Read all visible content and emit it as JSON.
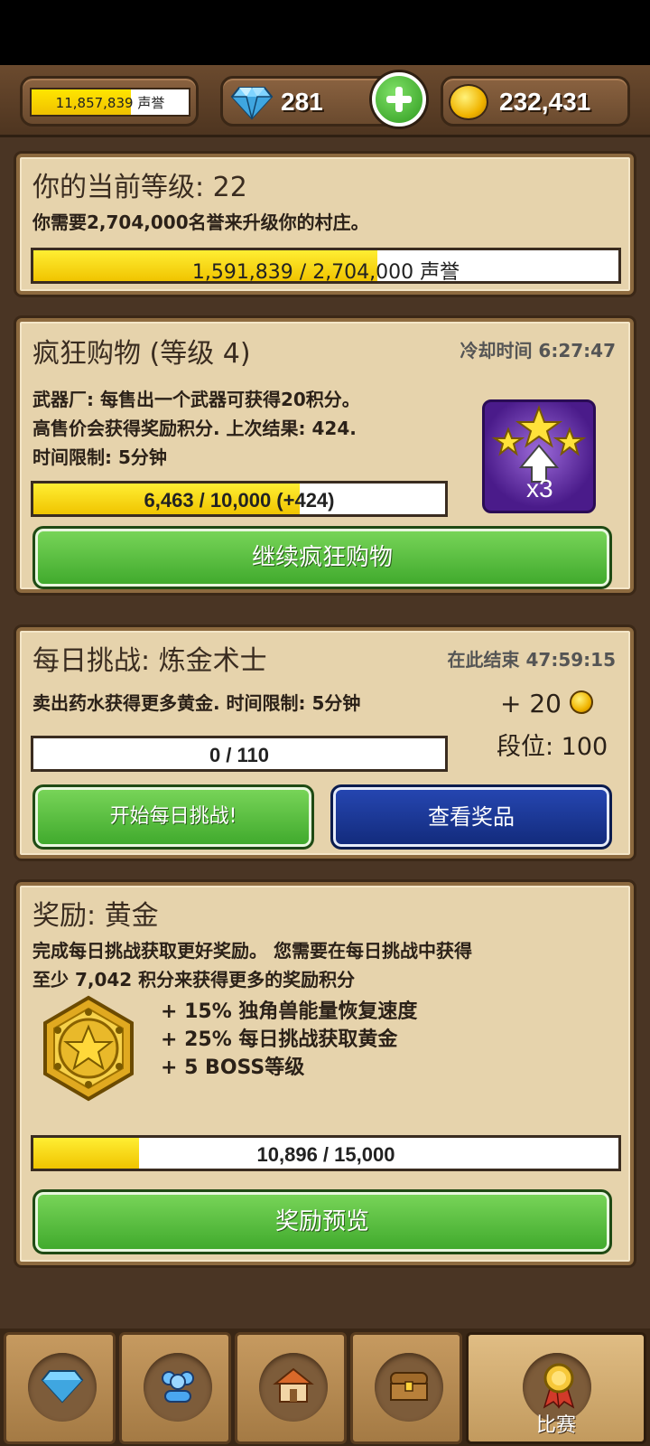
{
  "topbar": {
    "fame_text": "11,857,839 声誉",
    "fame_progress": 0.63,
    "gems": "281",
    "gold": "232,431"
  },
  "level_panel": {
    "title": "你的当前等级: 22",
    "description": "你需要2,704,000名誉来升级你的村庄。",
    "progress_text": "1,591,839 / 2,704,000 声誉",
    "progress": 0.5887
  },
  "shopping_panel": {
    "title": "疯狂购物 (等级 4)",
    "cooldown": "冷却时间 6:27:47",
    "line1": "武器厂: 每售出一个武器可获得20积分。",
    "line2": "高售价会获得奖励积分. 上次结果: 424.",
    "line3": "时间限制: 5分钟",
    "progress_text": "6,463 / 10,000 (+424)",
    "progress": 0.6463,
    "boost_label": "x3",
    "button": "继续疯狂购物"
  },
  "daily_panel": {
    "title": "每日挑战: 炼金术士",
    "ends": "在此结束 47:59:15",
    "description": "卖出药水获得更多黄金. 时间限制: 5分钟",
    "reward": "+ 20",
    "rank": "段位: 100",
    "progress_text": "0 / 110",
    "progress": 0,
    "start_button": "开始每日挑战!",
    "prizes_button": "查看奖品"
  },
  "reward_panel": {
    "title": "奖励: 黄金",
    "line1": "完成每日挑战获取更好奖励。 您需要在每日挑战中获得",
    "line2": "至少 7,042 积分来获得更多的奖励积分",
    "bonuses": [
      "+ 15% 独角兽能量恢复速度",
      "+ 25% 每日挑战获取黄金",
      "+ 5 BOSS等级"
    ],
    "progress_text": "10,896 / 15,000",
    "progress": 0.18,
    "button": "奖励预览"
  },
  "nav": {
    "tabs": [
      {
        "icon": "gem-icon",
        "label": ""
      },
      {
        "icon": "people-icon",
        "label": ""
      },
      {
        "icon": "house-icon",
        "label": ""
      },
      {
        "icon": "chest-icon",
        "label": ""
      },
      {
        "icon": "medal-icon",
        "label": "比赛"
      }
    ]
  }
}
